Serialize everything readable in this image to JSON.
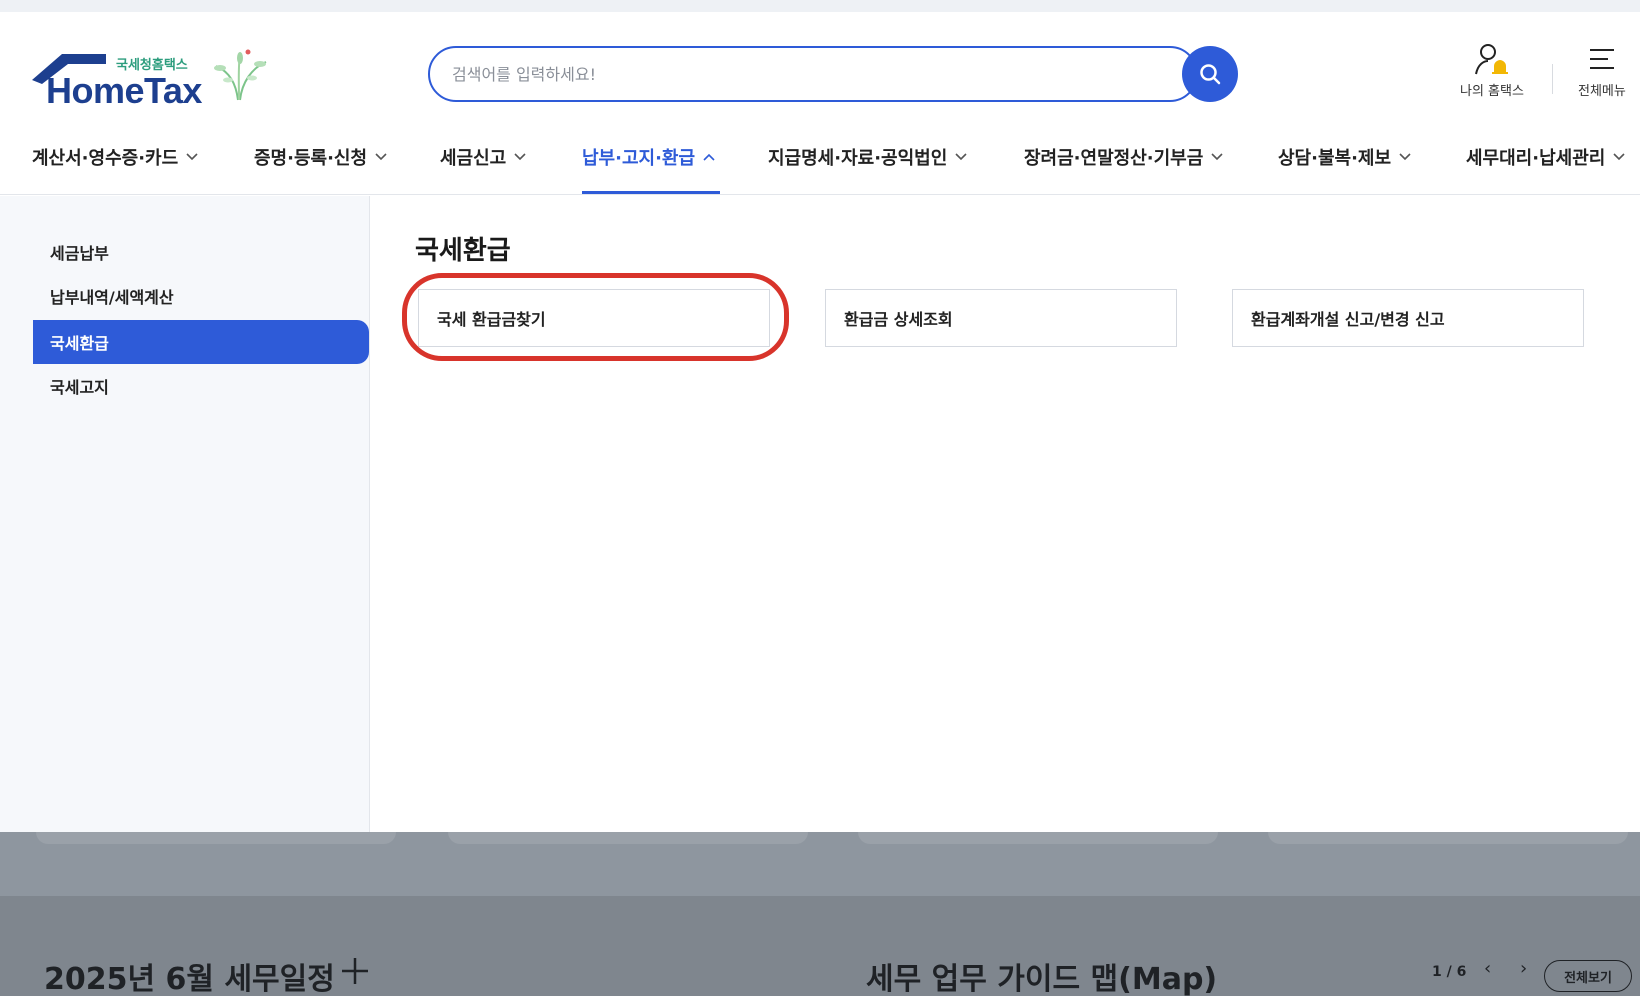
{
  "logo": {
    "sub": "국세청홈택스",
    "main": "HomeTax"
  },
  "search": {
    "placeholder": "검색어를 입력하세요!"
  },
  "utility": {
    "my_hometax": "나의 홈택스",
    "all_menu": "전체메뉴"
  },
  "gnb": [
    "계산서·영수증·카드",
    "증명·등록·신청",
    "세금신고",
    "납부·고지·환급",
    "지급명세·자료·공익법인",
    "장려금·연말정산·기부금",
    "상담·불복·제보",
    "세무대리·납세관리"
  ],
  "sidebar": [
    "세금납부",
    "납부내역/세액계산",
    "국세환급",
    "국세고지"
  ],
  "main": {
    "title": "국세환급",
    "cards": [
      "국세 환급금찾기",
      "환급금 상세조회",
      "환급계좌개설 신고/변경 신고"
    ]
  },
  "background": {
    "schedule_title": "2025년 6월 세무일정",
    "guide_title": "세무 업무 가이드 맵(Map)",
    "pager": "1 / 6",
    "view_all": "전체보기"
  },
  "colors": {
    "accent": "#2e5bd8",
    "highlight": "#d8342b"
  },
  "active_gnb_index": 3,
  "active_sidebar_index": 2
}
